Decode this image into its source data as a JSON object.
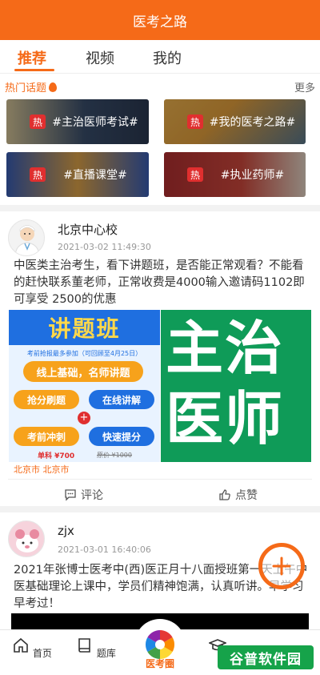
{
  "app": {
    "title": "医考之路",
    "accent": "#f56a18"
  },
  "tabs": [
    {
      "label": "推荐",
      "active": true
    },
    {
      "label": "视频",
      "active": false
    },
    {
      "label": "我的",
      "active": false
    }
  ],
  "hot_topics": {
    "title": "热门话题",
    "more": "更多",
    "badge": "热",
    "items": [
      {
        "label": "#主治医师考试#"
      },
      {
        "label": "#我的医考之路#"
      },
      {
        "label": "#直播课堂#"
      },
      {
        "label": "#执业药师#"
      }
    ]
  },
  "posts": [
    {
      "author": "北京中心校",
      "time": "2021-03-02 11:49:30",
      "text": "中医类主治考生，看下讲题班，是否能正常观看？不能看的赶快联系董老师，正常收费是4000输入邀请码1102即可享受 2500的优惠",
      "location": "北京市 北京市",
      "left_image": {
        "banner": "讲题班",
        "note": "考前抢报最多参加（可回顾至4月25日）",
        "mid": "线上基础，名师讲题",
        "row1_left": "抢分刷题",
        "row1_right": "在线讲解",
        "row2_left": "考前冲刺",
        "row2_right": "快速提分",
        "price_new": "单科 ¥700",
        "price_old": "原价 ¥1000"
      },
      "right_image": {
        "text": "主治医师"
      },
      "comment_label": "评论",
      "like_label": "点赞"
    },
    {
      "author": "zjx",
      "time": "2021-03-01 16:40:06",
      "text": "2021年张博士医考中(西)医正月十八面授班第一天上午中医基础理论上课中，学员们精神饱满，认真听讲。早学习早考过！"
    }
  ],
  "bottom_nav": [
    {
      "label": "首页",
      "icon": "home-icon"
    },
    {
      "label": "题库",
      "icon": "book-icon"
    },
    {
      "label": "医考圈",
      "icon": "aperture-icon",
      "active": true
    },
    {
      "label": "学",
      "icon": "graduation-cap-icon"
    }
  ],
  "watermark": "谷普软件园"
}
